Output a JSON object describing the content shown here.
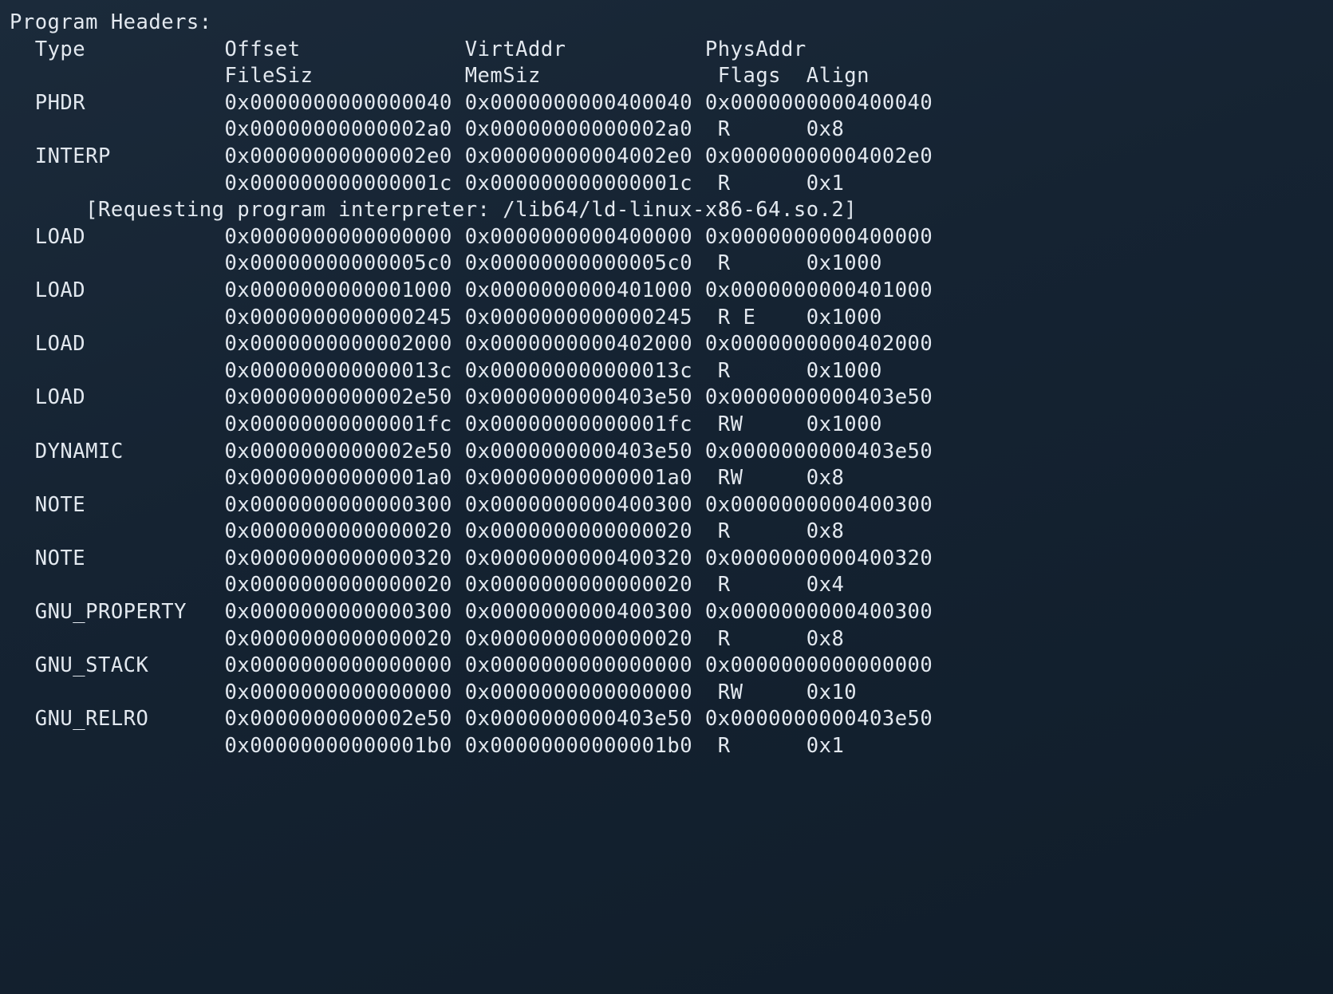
{
  "title": "Program Headers:",
  "header1": {
    "c1": "Type",
    "c2": "Offset",
    "c3": "VirtAddr",
    "c4": "PhysAddr"
  },
  "header2": {
    "c2": "FileSiz",
    "c3": "MemSiz",
    "c4": "Flags",
    "c5": "Align"
  },
  "interp_note": "[Requesting program interpreter: /lib64/ld-linux-x86-64.so.2]",
  "rows": [
    {
      "type": "PHDR",
      "offset": "0x0000000000000040",
      "virt": "0x0000000000400040",
      "phys": "0x0000000000400040",
      "filesiz": "0x00000000000002a0",
      "memsiz": "0x00000000000002a0",
      "flags": "R  ",
      "align": "0x8",
      "note": null
    },
    {
      "type": "INTERP",
      "offset": "0x00000000000002e0",
      "virt": "0x00000000004002e0",
      "phys": "0x00000000004002e0",
      "filesiz": "0x000000000000001c",
      "memsiz": "0x000000000000001c",
      "flags": "R  ",
      "align": "0x1",
      "note": "interp"
    },
    {
      "type": "LOAD",
      "offset": "0x0000000000000000",
      "virt": "0x0000000000400000",
      "phys": "0x0000000000400000",
      "filesiz": "0x00000000000005c0",
      "memsiz": "0x00000000000005c0",
      "flags": "R  ",
      "align": "0x1000",
      "note": null
    },
    {
      "type": "LOAD",
      "offset": "0x0000000000001000",
      "virt": "0x0000000000401000",
      "phys": "0x0000000000401000",
      "filesiz": "0x0000000000000245",
      "memsiz": "0x0000000000000245",
      "flags": "R E",
      "align": "0x1000",
      "note": null
    },
    {
      "type": "LOAD",
      "offset": "0x0000000000002000",
      "virt": "0x0000000000402000",
      "phys": "0x0000000000402000",
      "filesiz": "0x000000000000013c",
      "memsiz": "0x000000000000013c",
      "flags": "R  ",
      "align": "0x1000",
      "note": null
    },
    {
      "type": "LOAD",
      "offset": "0x0000000000002e50",
      "virt": "0x0000000000403e50",
      "phys": "0x0000000000403e50",
      "filesiz": "0x00000000000001fc",
      "memsiz": "0x00000000000001fc",
      "flags": "RW ",
      "align": "0x1000",
      "note": null
    },
    {
      "type": "DYNAMIC",
      "offset": "0x0000000000002e50",
      "virt": "0x0000000000403e50",
      "phys": "0x0000000000403e50",
      "filesiz": "0x00000000000001a0",
      "memsiz": "0x00000000000001a0",
      "flags": "RW ",
      "align": "0x8",
      "note": null
    },
    {
      "type": "NOTE",
      "offset": "0x0000000000000300",
      "virt": "0x0000000000400300",
      "phys": "0x0000000000400300",
      "filesiz": "0x0000000000000020",
      "memsiz": "0x0000000000000020",
      "flags": "R  ",
      "align": "0x8",
      "note": null
    },
    {
      "type": "NOTE",
      "offset": "0x0000000000000320",
      "virt": "0x0000000000400320",
      "phys": "0x0000000000400320",
      "filesiz": "0x0000000000000020",
      "memsiz": "0x0000000000000020",
      "flags": "R  ",
      "align": "0x4",
      "note": null
    },
    {
      "type": "GNU_PROPERTY",
      "offset": "0x0000000000000300",
      "virt": "0x0000000000400300",
      "phys": "0x0000000000400300",
      "filesiz": "0x0000000000000020",
      "memsiz": "0x0000000000000020",
      "flags": "R  ",
      "align": "0x8",
      "note": null
    },
    {
      "type": "GNU_STACK",
      "offset": "0x0000000000000000",
      "virt": "0x0000000000000000",
      "phys": "0x0000000000000000",
      "filesiz": "0x0000000000000000",
      "memsiz": "0x0000000000000000",
      "flags": "RW ",
      "align": "0x10",
      "note": null
    },
    {
      "type": "GNU_RELRO",
      "offset": "0x0000000000002e50",
      "virt": "0x0000000000403e50",
      "phys": "0x0000000000403e50",
      "filesiz": "0x00000000000001b0",
      "memsiz": "0x00000000000001b0",
      "flags": "R  ",
      "align": "0x1",
      "note": null
    }
  ]
}
